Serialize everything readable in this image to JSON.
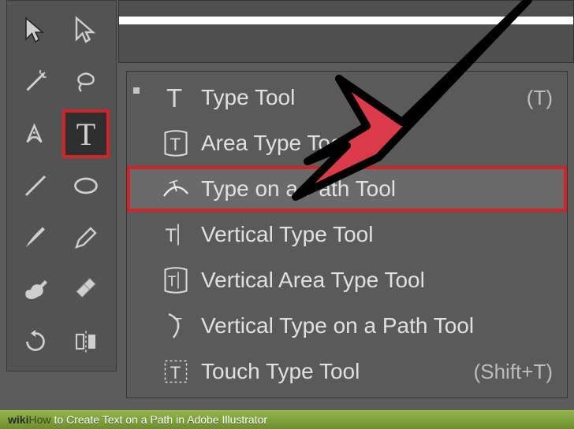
{
  "toolbar": {
    "tools": [
      {
        "name": "selection-tool"
      },
      {
        "name": "direct-selection-tool"
      },
      {
        "name": "magic-wand-tool"
      },
      {
        "name": "lasso-tool"
      },
      {
        "name": "pen-tool"
      },
      {
        "name": "type-tool",
        "selected": true
      },
      {
        "name": "line-segment-tool"
      },
      {
        "name": "ellipse-tool"
      },
      {
        "name": "paintbrush-tool"
      },
      {
        "name": "pencil-tool"
      },
      {
        "name": "blob-brush-tool"
      },
      {
        "name": "eraser-tool"
      },
      {
        "name": "rotate-tool"
      },
      {
        "name": "reflect-tool"
      }
    ]
  },
  "flyout": {
    "items": [
      {
        "icon": "type-icon",
        "label": "Type Tool",
        "shortcut": "(T)",
        "highlighted": false
      },
      {
        "icon": "area-type-icon",
        "label": "Area Type Tool",
        "shortcut": "",
        "highlighted": false
      },
      {
        "icon": "type-on-path-icon",
        "label": "Type on a Path Tool",
        "shortcut": "",
        "highlighted": true
      },
      {
        "icon": "vertical-type-icon",
        "label": "Vertical Type Tool",
        "shortcut": "",
        "highlighted": false
      },
      {
        "icon": "vertical-area-type-icon",
        "label": "Vertical Area Type Tool",
        "shortcut": "",
        "highlighted": false
      },
      {
        "icon": "vertical-type-on-path-icon",
        "label": "Vertical Type on a Path Tool",
        "shortcut": "",
        "highlighted": false
      },
      {
        "icon": "touch-type-icon",
        "label": "Touch Type Tool",
        "shortcut": "(Shift+T)",
        "highlighted": false
      }
    ]
  },
  "footer": {
    "brand": "wiki",
    "how": "How",
    "title": " to Create Text on a Path in Adobe Illustrator"
  }
}
